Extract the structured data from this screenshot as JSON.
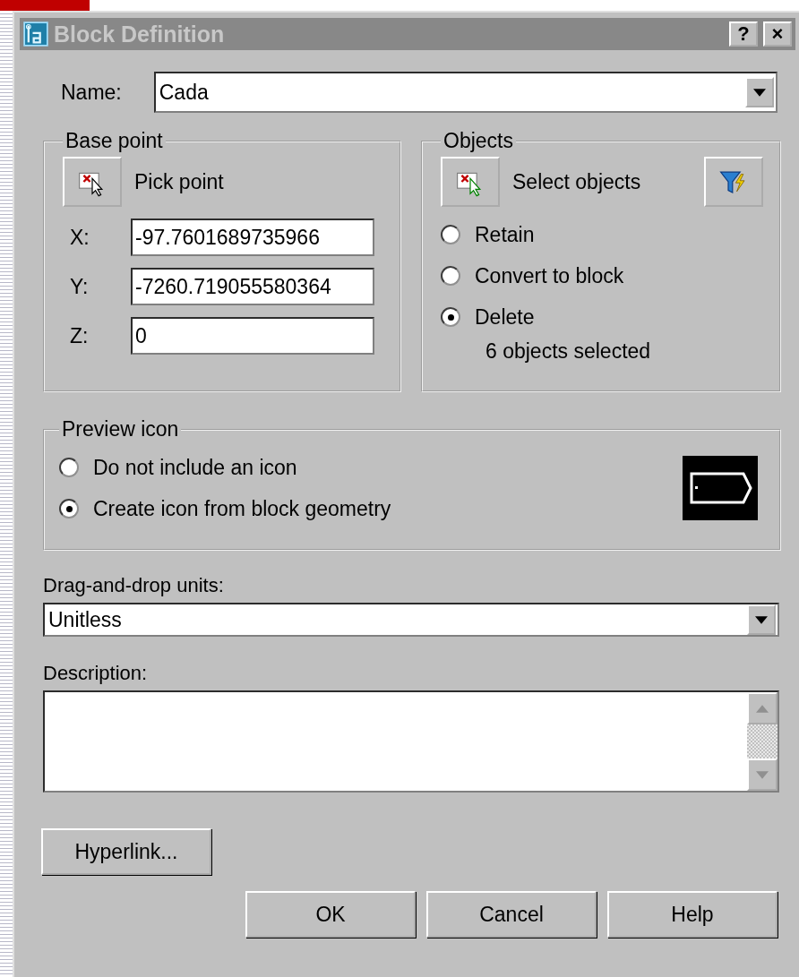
{
  "window": {
    "title": "Block Definition",
    "help_button": "?",
    "close_button": "×"
  },
  "name": {
    "label": "Name:",
    "value": "Cada"
  },
  "base_point": {
    "title": "Base point",
    "pick_button": "Pick point",
    "coords": [
      {
        "label": "X:",
        "value": "-97.7601689735966"
      },
      {
        "label": "Y:",
        "value": "-7260.719055580364"
      },
      {
        "label": "Z:",
        "value": "0"
      }
    ]
  },
  "objects": {
    "title": "Objects",
    "select_button": "Select objects",
    "options": [
      {
        "label": "Retain",
        "selected": false
      },
      {
        "label": "Convert to block",
        "selected": false
      },
      {
        "label": "Delete",
        "selected": true
      }
    ],
    "status": "6 objects selected"
  },
  "preview_icon": {
    "title": "Preview icon",
    "options": [
      {
        "label": "Do not include an icon",
        "selected": false
      },
      {
        "label": "Create icon from block geometry",
        "selected": true
      }
    ]
  },
  "units": {
    "label": "Drag-and-drop units:",
    "value": "Unitless"
  },
  "description": {
    "label": "Description:"
  },
  "hyperlink_button": "Hyperlink...",
  "buttons": [
    "OK",
    "Cancel",
    "Help"
  ]
}
